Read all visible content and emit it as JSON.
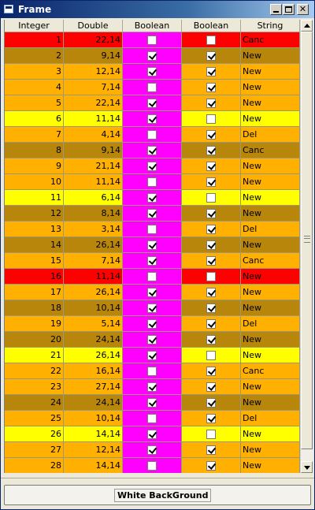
{
  "window": {
    "title": "Frame"
  },
  "table": {
    "headers": [
      "Integer",
      "Double",
      "Boolean",
      "Boolean",
      "String"
    ],
    "colors": {
      "red": "#ff0000",
      "olive": "#b8860b",
      "orange": "#ffb000",
      "yellow": "#ffff00",
      "magenta": "#ff00ff"
    },
    "rows": [
      {
        "integer": "1",
        "double": "22,14",
        "b1": false,
        "b2": false,
        "string": "Canc",
        "bg": "red"
      },
      {
        "integer": "2",
        "double": "9,14",
        "b1": true,
        "b2": true,
        "string": "New",
        "bg": "olive"
      },
      {
        "integer": "3",
        "double": "12,14",
        "b1": true,
        "b2": true,
        "string": "New",
        "bg": "orange"
      },
      {
        "integer": "4",
        "double": "7,14",
        "b1": false,
        "b2": true,
        "string": "New",
        "bg": "orange"
      },
      {
        "integer": "5",
        "double": "22,14",
        "b1": true,
        "b2": true,
        "string": "New",
        "bg": "orange"
      },
      {
        "integer": "6",
        "double": "11,14",
        "b1": true,
        "b2": false,
        "string": "New",
        "bg": "yellow"
      },
      {
        "integer": "7",
        "double": "4,14",
        "b1": false,
        "b2": true,
        "string": "Del",
        "bg": "orange"
      },
      {
        "integer": "8",
        "double": "9,14",
        "b1": true,
        "b2": true,
        "string": "Canc",
        "bg": "olive"
      },
      {
        "integer": "9",
        "double": "21,14",
        "b1": true,
        "b2": true,
        "string": "New",
        "bg": "orange"
      },
      {
        "integer": "10",
        "double": "11,14",
        "b1": false,
        "b2": true,
        "string": "New",
        "bg": "orange"
      },
      {
        "integer": "11",
        "double": "6,14",
        "b1": true,
        "b2": false,
        "string": "New",
        "bg": "yellow"
      },
      {
        "integer": "12",
        "double": "8,14",
        "b1": true,
        "b2": true,
        "string": "New",
        "bg": "olive"
      },
      {
        "integer": "13",
        "double": "3,14",
        "b1": false,
        "b2": true,
        "string": "Del",
        "bg": "orange"
      },
      {
        "integer": "14",
        "double": "26,14",
        "b1": true,
        "b2": true,
        "string": "New",
        "bg": "olive"
      },
      {
        "integer": "15",
        "double": "7,14",
        "b1": true,
        "b2": true,
        "string": "Canc",
        "bg": "orange"
      },
      {
        "integer": "16",
        "double": "11,14",
        "b1": false,
        "b2": false,
        "string": "New",
        "bg": "red"
      },
      {
        "integer": "17",
        "double": "26,14",
        "b1": true,
        "b2": true,
        "string": "New",
        "bg": "orange"
      },
      {
        "integer": "18",
        "double": "10,14",
        "b1": true,
        "b2": true,
        "string": "New",
        "bg": "olive"
      },
      {
        "integer": "19",
        "double": "5,14",
        "b1": true,
        "b2": true,
        "string": "Del",
        "bg": "orange"
      },
      {
        "integer": "20",
        "double": "24,14",
        "b1": true,
        "b2": true,
        "string": "New",
        "bg": "olive"
      },
      {
        "integer": "21",
        "double": "26,14",
        "b1": true,
        "b2": false,
        "string": "New",
        "bg": "yellow"
      },
      {
        "integer": "22",
        "double": "16,14",
        "b1": false,
        "b2": true,
        "string": "Canc",
        "bg": "orange"
      },
      {
        "integer": "23",
        "double": "27,14",
        "b1": true,
        "b2": true,
        "string": "New",
        "bg": "orange"
      },
      {
        "integer": "24",
        "double": "24,14",
        "b1": true,
        "b2": true,
        "string": "New",
        "bg": "olive"
      },
      {
        "integer": "25",
        "double": "10,14",
        "b1": false,
        "b2": true,
        "string": "Del",
        "bg": "orange"
      },
      {
        "integer": "26",
        "double": "14,14",
        "b1": true,
        "b2": false,
        "string": "New",
        "bg": "yellow"
      },
      {
        "integer": "27",
        "double": "12,14",
        "b1": true,
        "b2": true,
        "string": "New",
        "bg": "orange"
      },
      {
        "integer": "28",
        "double": "14,14",
        "b1": false,
        "b2": true,
        "string": "New",
        "bg": "orange"
      }
    ]
  },
  "bottom": {
    "button_label": "White BackGround"
  }
}
